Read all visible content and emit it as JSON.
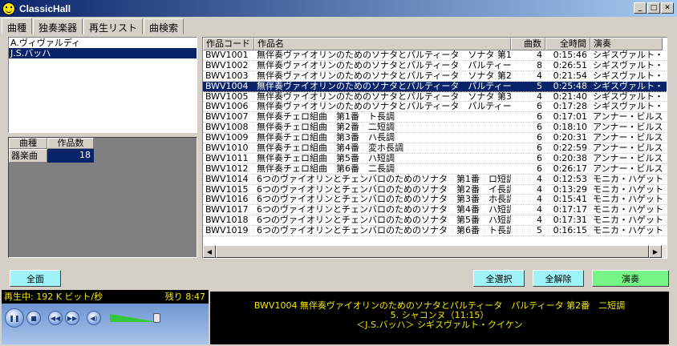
{
  "window": {
    "title": "ClassicHall"
  },
  "tabs": [
    "曲種",
    "独奏楽器",
    "再生リスト",
    "曲検索"
  ],
  "composers": [
    {
      "name": "A.ヴィヴァルディ",
      "selected": false
    },
    {
      "name": "J.S.バッハ",
      "selected": true
    }
  ],
  "genre_grid": {
    "headers": [
      "曲種",
      "作品数"
    ],
    "rows": [
      {
        "name": "器楽曲",
        "count": "18"
      }
    ]
  },
  "table": {
    "headers": [
      "作品コード",
      "作品名",
      "曲数",
      "全時間",
      "演奏"
    ],
    "rows": [
      {
        "code": "BWV1001",
        "title": "無伴奏ヴァイオリンのためのソナタとパルティータ　ソナタ 第1番　...",
        "tracks": "4",
        "time": "0:15:46",
        "artist": "シギスヴァルト・クイ"
      },
      {
        "code": "BWV1002",
        "title": "無伴奏ヴァイオリンのためのソナタとパルティータ　パルティータ 第...",
        "tracks": "8",
        "time": "0:26:51",
        "artist": "シギスヴァルト・クイ"
      },
      {
        "code": "BWV1003",
        "title": "無伴奏ヴァイオリンのためのソナタとパルティータ　ソナタ 第2番　...",
        "tracks": "4",
        "time": "0:21:54",
        "artist": "シギスヴァルト・クイ"
      },
      {
        "code": "BWV1004",
        "title": "無伴奏ヴァイオリンのためのソナタとパルティータ　パルティータ 第...",
        "tracks": "5",
        "time": "0:25:48",
        "artist": "シギスヴァルト・クイ",
        "selected": true
      },
      {
        "code": "BWV1005",
        "title": "無伴奏ヴァイオリンのためのソナタとパルティータ　ソナタ 第3番　...",
        "tracks": "4",
        "time": "0:21:40",
        "artist": "シギスヴァルト・クイ"
      },
      {
        "code": "BWV1006",
        "title": "無伴奏ヴァイオリンのためのソナタとパルティータ　パルティータ 第...",
        "tracks": "6",
        "time": "0:17:28",
        "artist": "シギスヴァルト・クイ"
      },
      {
        "code": "BWV1007",
        "title": "無伴奏チェロ組曲　第1番　ト長調",
        "tracks": "6",
        "time": "0:17:01",
        "artist": "アンナー・ビルスマ"
      },
      {
        "code": "BWV1008",
        "title": "無伴奏チェロ組曲　第2番　二短調",
        "tracks": "6",
        "time": "0:18:10",
        "artist": "アンナー・ビルスマ"
      },
      {
        "code": "BWV1009",
        "title": "無伴奏チェロ組曲　第3番　ハ長調",
        "tracks": "6",
        "time": "0:20:31",
        "artist": "アンナー・ビルスマ"
      },
      {
        "code": "BWV1010",
        "title": "無伴奏チェロ組曲　第4番　変ホ長調",
        "tracks": "6",
        "time": "0:22:59",
        "artist": "アンナー・ビルスマ"
      },
      {
        "code": "BWV1011",
        "title": "無伴奏チェロ組曲　第5番　ハ短調",
        "tracks": "6",
        "time": "0:20:38",
        "artist": "アンナー・ビルスマ"
      },
      {
        "code": "BWV1012",
        "title": "無伴奏チェロ組曲　第6番　二長調",
        "tracks": "6",
        "time": "0:26:17",
        "artist": "アンナー・ビルスマ"
      },
      {
        "code": "BWV1014",
        "title": "6つのヴァイオリンとチェンバロのためのソナタ　第1番　ロ短調",
        "tracks": "4",
        "time": "0:12:53",
        "artist": "モニカ・ハゲット/ト"
      },
      {
        "code": "BWV1015",
        "title": "6つのヴァイオリンとチェンバロのためのソナタ　第2番　イ長調",
        "tracks": "4",
        "time": "0:13:29",
        "artist": "モニカ・ハゲット/ト"
      },
      {
        "code": "BWV1016",
        "title": "6つのヴァイオリンとチェンバロのためのソナタ　第3番　ホ長調",
        "tracks": "4",
        "time": "0:15:41",
        "artist": "モニカ・ハゲット/ト"
      },
      {
        "code": "BWV1017",
        "title": "6つのヴァイオリンとチェンバロのためのソナタ　第4番　ハ短調",
        "tracks": "4",
        "time": "0:17:17",
        "artist": "モニカ・ハゲット/ト"
      },
      {
        "code": "BWV1018",
        "title": "6つのヴァイオリンとチェンバロのためのソナタ　第5番　ハ短調",
        "tracks": "4",
        "time": "0:17:31",
        "artist": "モニカ・ハゲット/ト"
      },
      {
        "code": "BWV1019",
        "title": "6つのヴァイオリンとチェンバロのためのソナタ　第6番　ト長調",
        "tracks": "5",
        "time": "0:16:15",
        "artist": "モニカ・ハゲット/ト"
      }
    ]
  },
  "buttons": {
    "full": "全面",
    "select_all": "全選択",
    "deselect_all": "全解除",
    "play": "演奏"
  },
  "player": {
    "status": "再生中: 192 K ビット/秒",
    "remaining": "残り 8:47",
    "volume_pct": 85
  },
  "now_playing": [
    "BWV1004 無伴奏ヴァイオリンのためのソナタとパルティータ　パルティータ 第2番　二短調",
    "5. シャコンヌ（11:15）",
    "＜J.S.バッハ＞ シギスヴァルト・クイケン"
  ],
  "colors": {
    "accent": "#0a246a",
    "button_cyan": "#9ff3f8",
    "button_green": "#75f585",
    "text_yellow": "#f3e800"
  }
}
